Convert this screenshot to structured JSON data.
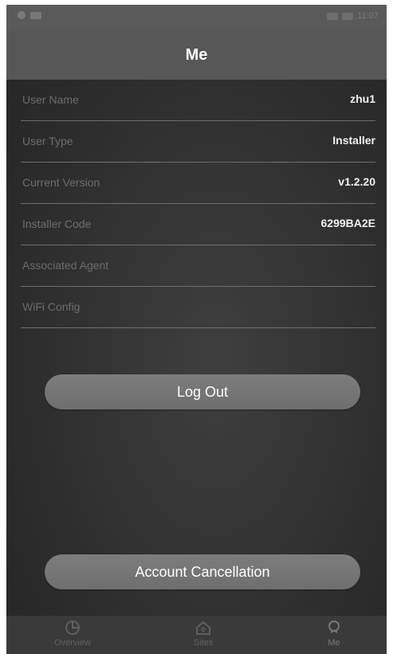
{
  "status_bar": {
    "left_icons": [
      "circle-icon",
      "signal-icon"
    ],
    "right_text": "11:07"
  },
  "header": {
    "title": "Me"
  },
  "profile_rows": [
    {
      "label": "User Name",
      "value": "zhu1"
    },
    {
      "label": "User Type",
      "value": "Installer"
    },
    {
      "label": "Current Version",
      "value": "v1.2.20"
    },
    {
      "label": "Installer Code",
      "value": "6299BA2E"
    },
    {
      "label": "Associated Agent",
      "value": ""
    },
    {
      "label": "WiFi Config",
      "value": ""
    }
  ],
  "buttons": {
    "logout_label": "Log Out",
    "account_cancellation_label": "Account Cancellation"
  },
  "tabbar": {
    "tabs": [
      {
        "label": "Overview",
        "icon": "pie-chart-icon"
      },
      {
        "label": "Sites",
        "icon": "home-icon"
      },
      {
        "label": "Me",
        "icon": "user-icon"
      }
    ],
    "active_tab": "Me"
  },
  "colors": {
    "header_bg": "#575757",
    "background": "#2f2f2f",
    "button_bg": "#757575",
    "label_text": "#6c6c6c",
    "value_text": "#f2f2f2"
  }
}
